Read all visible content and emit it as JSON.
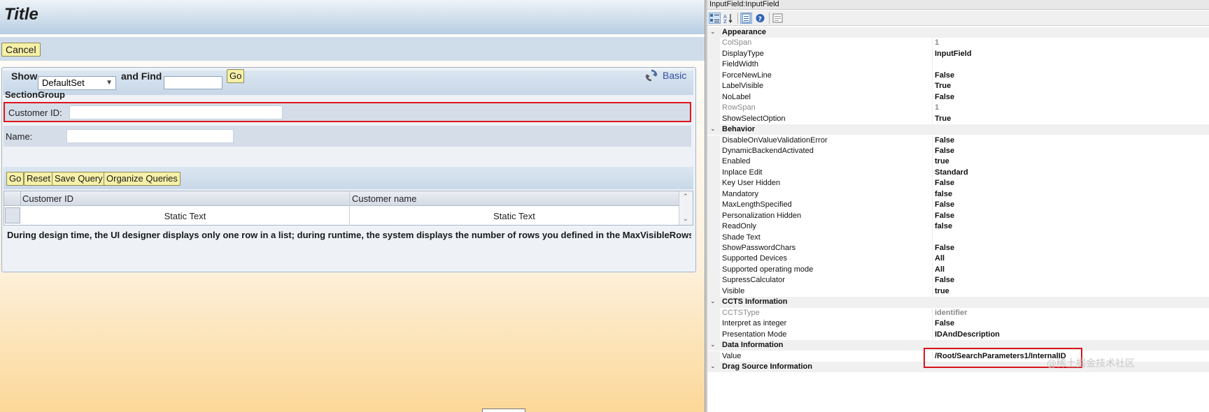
{
  "designer": {
    "title": "Title",
    "cancel_label": "Cancel",
    "search": {
      "show_label": "Show",
      "show_value": "DefaultSet",
      "and_find_label": "and Find",
      "find_value": "",
      "go_label": "Go",
      "basic_label": "Basic"
    },
    "section_group": "SectionGroup",
    "customer_id_label": "Customer ID:",
    "customer_id_value": "",
    "name_label": "Name:",
    "name_value": "",
    "query_buttons": {
      "go": "Go",
      "reset": "Reset",
      "save_query": "Save Query",
      "organize_queries": "Organize Queries"
    },
    "table": {
      "columns": [
        "Customer ID",
        "Customer name"
      ],
      "rows": [
        [
          "Static Text",
          "Static Text"
        ]
      ]
    },
    "design_note": "During design time, the UI designer displays only one row in a list; during runtime, the system displays the number of rows you defined in the MaxVisibleRows prope"
  },
  "properties": {
    "caption": "InputField:InputField",
    "rows": [
      {
        "type": "category",
        "name": "Appearance"
      },
      {
        "name": "ColSpan",
        "value": "1",
        "dim": true
      },
      {
        "name": "DisplayType",
        "value": "InputField"
      },
      {
        "name": "FieldWidth",
        "value": ""
      },
      {
        "name": "ForceNewLine",
        "value": "False"
      },
      {
        "name": "LabelVisible",
        "value": "True"
      },
      {
        "name": "NoLabel",
        "value": "False"
      },
      {
        "name": "RowSpan",
        "value": "1",
        "dim": true
      },
      {
        "name": "ShowSelectOption",
        "value": "True"
      },
      {
        "type": "category",
        "name": "Behavior"
      },
      {
        "name": "DisableOnValueValidationError",
        "value": "False"
      },
      {
        "name": "DynamicBackendActivated",
        "value": "False"
      },
      {
        "name": "Enabled",
        "value": "true"
      },
      {
        "name": "Inplace Edit",
        "value": "Standard"
      },
      {
        "name": "Key User Hidden",
        "value": "False"
      },
      {
        "name": "Mandatory",
        "value": "false"
      },
      {
        "name": "MaxLengthSpecified",
        "value": "False"
      },
      {
        "name": "Personalization Hidden",
        "value": "False"
      },
      {
        "name": "ReadOnly",
        "value": "false"
      },
      {
        "name": "Shade Text",
        "value": ""
      },
      {
        "name": "ShowPasswordChars",
        "value": "False"
      },
      {
        "name": "Supported Devices",
        "value": "All"
      },
      {
        "name": "Supported operating mode",
        "value": "All"
      },
      {
        "name": "SupressCalculator",
        "value": "False"
      },
      {
        "name": "Visible",
        "value": "true"
      },
      {
        "type": "category",
        "name": "CCTS Information"
      },
      {
        "name": "CCTSType",
        "value": "identifier",
        "dim": true
      },
      {
        "name": "Interpret as integer",
        "value": "False"
      },
      {
        "name": "Presentation Mode",
        "value": "IDAndDescription"
      },
      {
        "type": "category",
        "name": "Data Information"
      },
      {
        "name": "Value",
        "value": "/Root/SearchParameters1/InternalID"
      },
      {
        "type": "category",
        "name": "Drag Source Information"
      }
    ]
  },
  "watermark": "@稀土掘金技术社区",
  "colors": {
    "highlight": "#e0141c",
    "button_bg": "#f6f0a8",
    "panel_blue": "#cfdcea"
  }
}
